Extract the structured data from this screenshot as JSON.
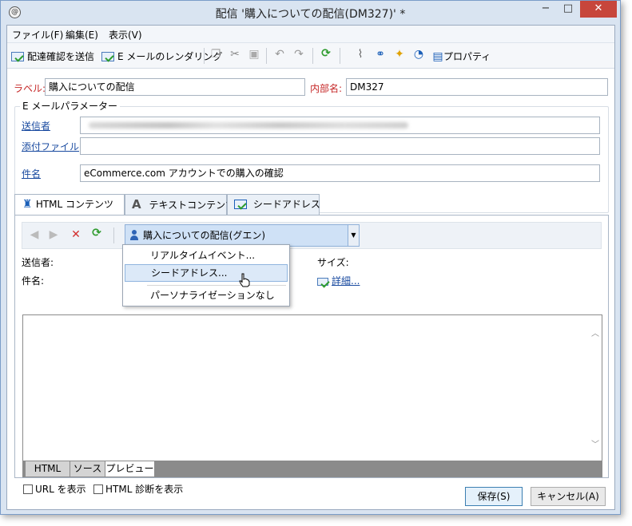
{
  "window": {
    "title": "配信 '購入についての配信(DM327)' *",
    "minimize": "−",
    "maximize": "□",
    "close": "✕"
  },
  "menu": [
    "ファイル(F)",
    "編集(E)",
    "表示(V)"
  ],
  "toolbar": {
    "send_proof": "配達確認を送信",
    "email_rendering": "E メールのレンダリング",
    "properties": "プロパティ"
  },
  "form": {
    "label_caption": "ラベル:",
    "label_value": "購入についての配信",
    "internal_name_caption": "内部名:",
    "internal_name_value": "DM327",
    "group_title": "E メールパラメーター",
    "sender_caption": "送信者",
    "attachments_caption": "添付ファイル",
    "subject_caption": "件名",
    "subject_value": "eCommerce.com アカウントでの購入の確認"
  },
  "tabs": [
    "HTML コンテンツ",
    "テキストコンテンツ",
    "シードアドレス"
  ],
  "content": {
    "personalization_selected": "購入についての配信(グエン)",
    "dropdown_options": [
      "リアルタイムイベント...",
      "シードアドレス...",
      "パーソナライゼーションなし"
    ],
    "sender_label": "送信者:",
    "subject_label": "件名:",
    "size_label": "サイズ:",
    "details_link": "詳細...",
    "bottom_tabs": [
      "HTML",
      "ソース",
      "プレビュー"
    ],
    "show_url": "URL を表示",
    "show_html_diagnosis": "HTML 診断を表示"
  },
  "buttons": {
    "save": "保存(S)",
    "cancel": "キャンセル(A)"
  },
  "colors": {
    "accent": "#1a4ba0",
    "required_label": "#c62828",
    "close_button": "#c7463b"
  }
}
